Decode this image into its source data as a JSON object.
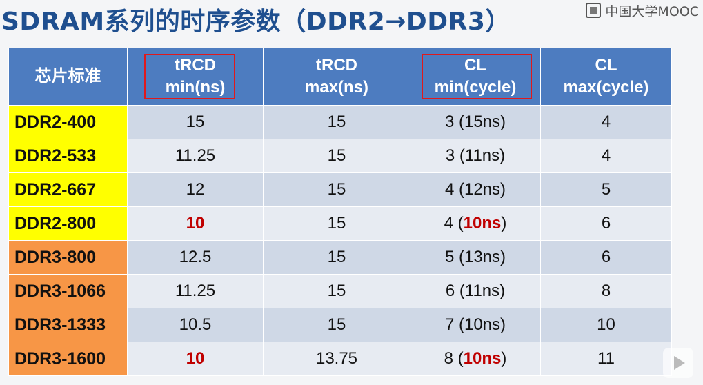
{
  "title": "SDRAM系列的时序参数（DDR2→DDR3）",
  "logo": {
    "text": "中国大学MOOC",
    "icon": "mooc-logo-icon"
  },
  "colors": {
    "title": "#1f4f8f",
    "header_bg": "#4d7cc0",
    "ddr2_bg": "#ffff00",
    "ddr3_bg": "#f79646",
    "highlight": "#c00000",
    "box_border": "#e0191c"
  },
  "table": {
    "headers": [
      {
        "line1": "芯片标准",
        "line2": ""
      },
      {
        "line1": "tRCD",
        "line2": "min(ns)",
        "boxed": true
      },
      {
        "line1": "tRCD",
        "line2": "max(ns)"
      },
      {
        "line1": "CL",
        "line2": "min(cycle)",
        "boxed": true
      },
      {
        "line1": "CL",
        "line2": "max(cycle)"
      }
    ],
    "rows": [
      {
        "standard": "DDR2-400",
        "family": "ddr2",
        "trcd_min": "15",
        "trcd_min_hl": false,
        "trcd_max": "15",
        "cl_prefix": "3 (",
        "cl_ns": "15ns",
        "cl_ns_hl": false,
        "cl_suffix": ")",
        "cl_max": "4"
      },
      {
        "standard": "DDR2-533",
        "family": "ddr2",
        "trcd_min": "11.25",
        "trcd_min_hl": false,
        "trcd_max": "15",
        "cl_prefix": "3 (",
        "cl_ns": "11ns",
        "cl_ns_hl": false,
        "cl_suffix": ")",
        "cl_max": "4"
      },
      {
        "standard": "DDR2-667",
        "family": "ddr2",
        "trcd_min": "12",
        "trcd_min_hl": false,
        "trcd_max": "15",
        "cl_prefix": "4 (",
        "cl_ns": "12ns",
        "cl_ns_hl": false,
        "cl_suffix": ")",
        "cl_max": "5"
      },
      {
        "standard": "DDR2-800",
        "family": "ddr2",
        "trcd_min": "10",
        "trcd_min_hl": true,
        "trcd_max": "15",
        "cl_prefix": "4 (",
        "cl_ns": "10ns",
        "cl_ns_hl": true,
        "cl_suffix": ")",
        "cl_max": "6"
      },
      {
        "standard": "DDR3-800",
        "family": "ddr3",
        "trcd_min": "12.5",
        "trcd_min_hl": false,
        "trcd_max": "15",
        "cl_prefix": "5 (",
        "cl_ns": "13ns",
        "cl_ns_hl": false,
        "cl_suffix": ")",
        "cl_max": "6"
      },
      {
        "standard": "DDR3-1066",
        "family": "ddr3",
        "trcd_min": "11.25",
        "trcd_min_hl": false,
        "trcd_max": "15",
        "cl_prefix": "6 (",
        "cl_ns": "11ns",
        "cl_ns_hl": false,
        "cl_suffix": ")",
        "cl_max": "8"
      },
      {
        "standard": "DDR3-1333",
        "family": "ddr3",
        "trcd_min": "10.5",
        "trcd_min_hl": false,
        "trcd_max": "15",
        "cl_prefix": "7 (",
        "cl_ns": "10ns",
        "cl_ns_hl": false,
        "cl_suffix": ")",
        "cl_max": "10"
      },
      {
        "standard": "DDR3-1600",
        "family": "ddr3",
        "trcd_min": "10",
        "trcd_min_hl": true,
        "trcd_max": "13.75",
        "cl_prefix": "8 (",
        "cl_ns": "10ns",
        "cl_ns_hl": true,
        "cl_suffix": ")",
        "cl_max": "11"
      }
    ]
  },
  "player": {
    "icon": "play-icon"
  }
}
